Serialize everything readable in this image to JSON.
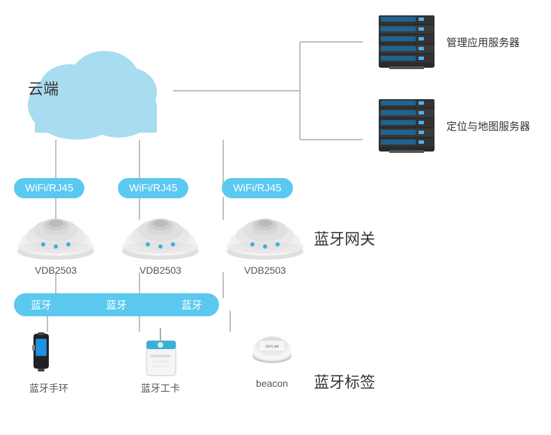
{
  "cloud": {
    "label": "云端"
  },
  "servers": [
    {
      "label": "管理应用服务器"
    },
    {
      "label": "定位与地图服务器"
    }
  ],
  "wifi_badges": [
    {
      "text": "WiFi/RJ45"
    },
    {
      "text": "WiFi/RJ45"
    },
    {
      "text": "WiFi/RJ45"
    }
  ],
  "gateways": [
    {
      "model": "VDB2503"
    },
    {
      "model": "VDB2503"
    },
    {
      "model": "VDB2503"
    }
  ],
  "gateway_title": "蓝牙网关",
  "bt_badges": [
    {
      "text": "蓝牙"
    },
    {
      "text": "蓝牙"
    },
    {
      "text": "蓝牙"
    }
  ],
  "tags": [
    {
      "label": "蓝牙手环"
    },
    {
      "label": "蓝牙工卡"
    },
    {
      "label": "beacon"
    }
  ],
  "tag_title": "蓝牙标签"
}
